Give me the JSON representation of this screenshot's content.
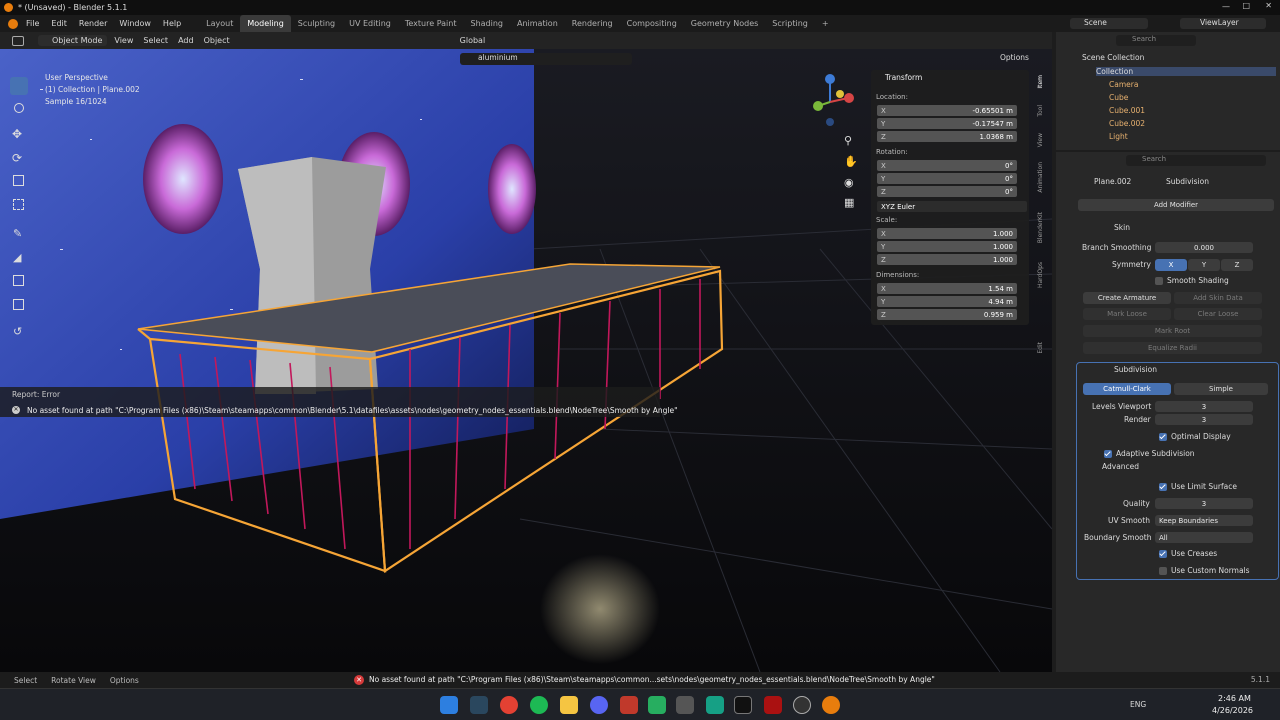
{
  "title": "* (Unsaved) - Blender 5.1.1",
  "menus": [
    "File",
    "Edit",
    "Render",
    "Window",
    "Help"
  ],
  "workspaces": [
    "Layout",
    "Modeling",
    "Sculpting",
    "UV Editing",
    "Texture Paint",
    "Shading",
    "Animation",
    "Rendering",
    "Compositing",
    "Geometry Nodes",
    "Scripting"
  ],
  "active_workspace": "Modeling",
  "plus": "+",
  "scene": "Scene",
  "viewlayer": "ViewLayer",
  "viewport_header": {
    "mode": "Object Mode",
    "view": "View",
    "select": "Select",
    "add": "Add",
    "object": "Object",
    "orientation": "Global",
    "options": "Options",
    "filter_value": "aluminium"
  },
  "overlay_text": {
    "perspective": "User Perspective",
    "collection": "(1) Collection | Plane.002",
    "sample": "Sample 16/1024"
  },
  "error_report": {
    "title": "Report: Error",
    "message": "No asset found at path \"C:\\Program Files (x86)\\Steam\\steamapps\\common\\Blender\\5.1\\datafiles\\assets\\nodes\\geometry_nodes_essentials.blend\\NodeTree\\Smooth by Angle\""
  },
  "transform": {
    "header": "Transform",
    "location_label": "Location:",
    "location": [
      {
        "axis": "X",
        "value": "-0.65501 m"
      },
      {
        "axis": "Y",
        "value": "-0.17547 m"
      },
      {
        "axis": "Z",
        "value": "1.0368 m"
      }
    ],
    "rotation_label": "Rotation:",
    "rotation": [
      {
        "axis": "X",
        "value": "0°"
      },
      {
        "axis": "Y",
        "value": "0°"
      },
      {
        "axis": "Z",
        "value": "0°"
      }
    ],
    "rotation_mode": "XYZ Euler",
    "scale_label": "Scale:",
    "scale": [
      {
        "axis": "X",
        "value": "1.000"
      },
      {
        "axis": "Y",
        "value": "1.000"
      },
      {
        "axis": "Z",
        "value": "1.000"
      }
    ],
    "dimensions_label": "Dimensions:",
    "dimensions": [
      {
        "axis": "X",
        "value": "1.54 m"
      },
      {
        "axis": "Y",
        "value": "4.94 m"
      },
      {
        "axis": "Z",
        "value": "0.959 m"
      }
    ]
  },
  "side_tabs": [
    "Item",
    "Tool",
    "View",
    "Animation",
    "BlenderKit",
    "HardOps",
    "Edit"
  ],
  "outliner": {
    "search_placeholder": "Search",
    "items": [
      {
        "name": "Scene Collection"
      },
      {
        "name": "Collection"
      },
      {
        "name": "Camera"
      },
      {
        "name": "Cube"
      },
      {
        "name": "Cube.001"
      },
      {
        "name": "Cube.002"
      },
      {
        "name": "Light"
      }
    ]
  },
  "properties": {
    "search_placeholder": "Search",
    "object": "Plane.002",
    "context": "Subdivision",
    "add_modifier": "Add Modifier",
    "skin": {
      "name": "Skin",
      "branch_smoothing_label": "Branch Smoothing",
      "branch_smoothing": "0.000",
      "symmetry_label": "Symmetry",
      "symmetry": [
        "X",
        "Y",
        "Z"
      ],
      "smooth_shading": "Smooth Shading",
      "create_armature": "Create Armature",
      "add_skin_data": "Add Skin Data",
      "mark_loose": "Mark Loose",
      "clear_loose": "Clear Loose",
      "mark_root": "Mark Root",
      "equalize_radii": "Equalize Radii"
    },
    "subdivision": {
      "name": "Subdivision",
      "catmull": "Catmull-Clark",
      "simple": "Simple",
      "levels_viewport_label": "Levels Viewport",
      "levels_viewport": "3",
      "render_label": "Render",
      "render": "3",
      "optimal_display": "Optimal Display",
      "adaptive": "Adaptive Subdivision",
      "advanced": "Advanced",
      "use_limit_surface": "Use Limit Surface",
      "quality_label": "Quality",
      "quality": "3",
      "uv_smooth_label": "UV Smooth",
      "uv_smooth": "Keep Boundaries",
      "boundary_smooth_label": "Boundary Smooth",
      "boundary_smooth": "All",
      "use_creases": "Use Creases",
      "use_custom_normals": "Use Custom Normals"
    }
  },
  "statusbar": {
    "select": "Select",
    "rotate": "Rotate View",
    "options": "Options",
    "error": "No asset found at path \"C:\\Program Files (x86)\\Steam\\steamapps\\common...sets\\nodes\\geometry_nodes_essentials.blend\\NodeTree\\Smooth by Angle\"",
    "version": "5.1.1"
  },
  "taskbar": {
    "time": "2:46 AM",
    "date": "4/26/2026",
    "lang": "ENG"
  },
  "colors": {
    "accent": "#4772b3",
    "selection_orange": "#f6a536",
    "error_red": "#d63a3a"
  }
}
